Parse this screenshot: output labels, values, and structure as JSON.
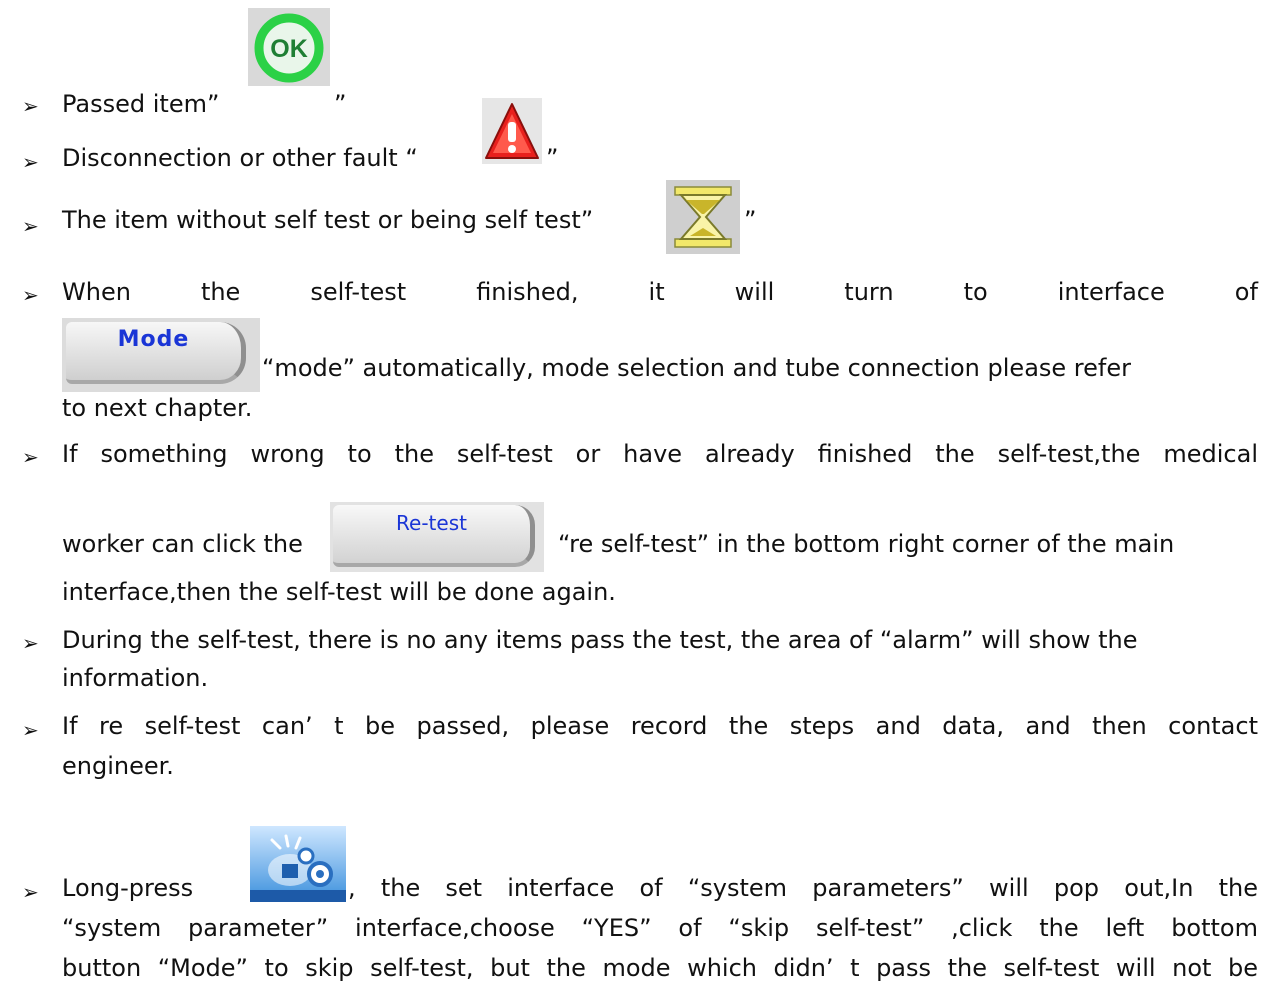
{
  "bullet": "➢",
  "items": {
    "passed": {
      "before": "Passed item”",
      "after": "”",
      "icon": "ok-icon",
      "icon_text": "OK"
    },
    "fault": {
      "before": "Disconnection or other fault  “",
      "after": "”",
      "icon": "warning-icon"
    },
    "pending": {
      "before": "The item without self test or being self test”",
      "after": "”",
      "icon": "hourglass-icon"
    },
    "finished": {
      "words": [
        "When",
        "the",
        "self-test",
        "finished,",
        "it",
        "will",
        "turn",
        "to",
        "interface",
        "of"
      ],
      "button_label": "Mode",
      "after_button": "“mode” automatically, mode selection and tube connection please refer",
      "line3": "to next chapter."
    },
    "retest": {
      "line1": "If something wrong to the self-test or have already finished the self-test,the medical",
      "before_button": "worker can click the",
      "button_label": "Re-test",
      "after_button": "“re self-test” in the bottom right corner of the main",
      "line3": "interface,then the self-test will be done again."
    },
    "alarm": {
      "line1": "During the self-test, there is no any items pass the test, the area of  “alarm” will show the",
      "line2": "information."
    },
    "record": {
      "line1": "If re self-test can’ t be passed, please record the steps and data, and then contact",
      "line2": "engineer."
    },
    "longpress": {
      "before_icon": "Long-press",
      "icon": "system-settings-icon",
      "after_icon": ", the set interface of  “system parameters”  will pop out,In the",
      "line2": " “system parameter” interface,choose  “YES”  of  “skip self-test” ,click the left bottom",
      "line3": "button “Mode” to skip self-test, but the mode which didn’ t pass the self-test will not be"
    }
  }
}
